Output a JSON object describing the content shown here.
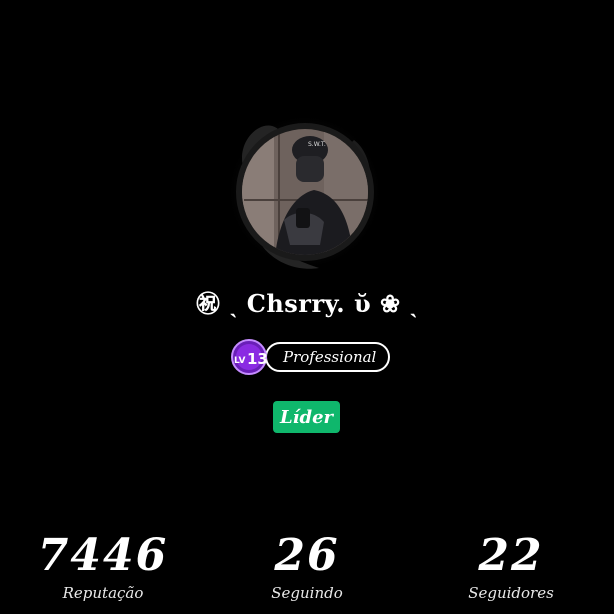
{
  "profile": {
    "username": "㊗ ˎ Chsrry. ῠ ❀ ˎ",
    "level": {
      "prefix": "LV",
      "number": "13",
      "title": "Professional",
      "badge_color": "#8a2be2"
    },
    "role": "Líder",
    "role_color": "#0fb76c"
  },
  "stats": [
    {
      "value": "7446",
      "label": "Reputação"
    },
    {
      "value": "26",
      "label": "Seguindo"
    },
    {
      "value": "22",
      "label": "Seguidores"
    }
  ],
  "icons": {
    "avatar": "profile-avatar-image",
    "level": "level-badge-icon"
  }
}
